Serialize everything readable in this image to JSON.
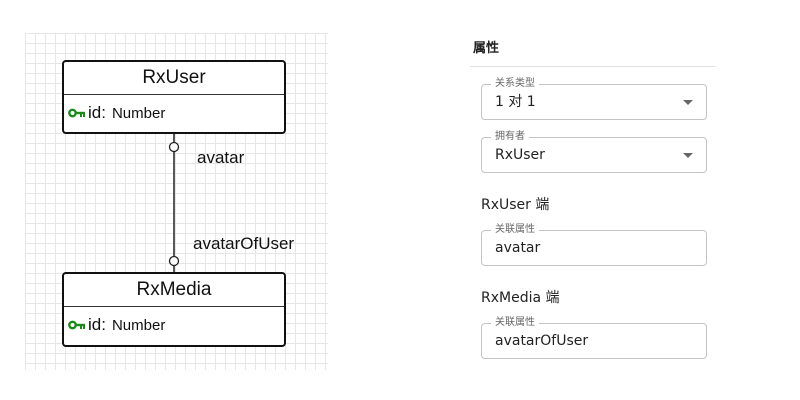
{
  "diagram": {
    "entities": [
      {
        "name": "RxUser",
        "attributes": [
          {
            "name": "id:",
            "type": "Number",
            "icon": "key-icon"
          }
        ]
      },
      {
        "name": "RxMedia",
        "attributes": [
          {
            "name": "id:",
            "type": "Number",
            "icon": "key-icon"
          }
        ]
      }
    ],
    "relation": {
      "source_label": "avatar",
      "target_label": "avatarOfUser"
    },
    "colors": {
      "key_icon": "#1b8a1b",
      "border": "#111111",
      "grid": "#e6e6e6"
    }
  },
  "panel": {
    "title": "属性",
    "relation_type": {
      "label": "关系类型",
      "value": "1 对 1"
    },
    "owner": {
      "label": "拥有者",
      "value": "RxUser"
    },
    "source_section": {
      "title": "RxUser 端",
      "field_label": "关联属性",
      "value": "avatar"
    },
    "target_section": {
      "title": "RxMedia 端",
      "field_label": "关联属性",
      "value": "avatarOfUser"
    }
  }
}
